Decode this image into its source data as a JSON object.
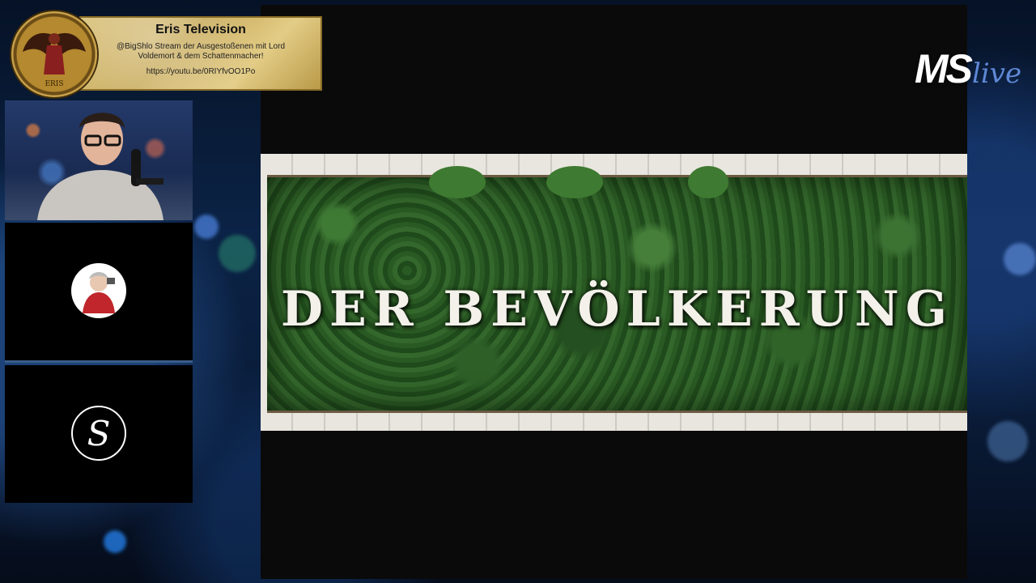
{
  "overlay": {
    "channel_title": "Eris Television",
    "description": "@BigShlo Stream der Ausgestoßenen mit Lord Voldemort & dem Schattenmacher!",
    "link": "https://youtu.be/0RIYfvOO1Po",
    "seal_text": "ERIS"
  },
  "main_video": {
    "scene_text": "DER BEVÖLKERUNG"
  },
  "logo": {
    "ms": "MS",
    "live": "live"
  },
  "guests": [
    {
      "avatar_icon": "person-cartoon-avatar-icon"
    },
    {
      "avatar_icon": "s-letter-logo-icon",
      "avatar_letter": "S"
    }
  ],
  "colors": {
    "plaque_gold": "#c6a855",
    "logo_blue": "#5f88d6",
    "background_blue": "#0b2346"
  }
}
